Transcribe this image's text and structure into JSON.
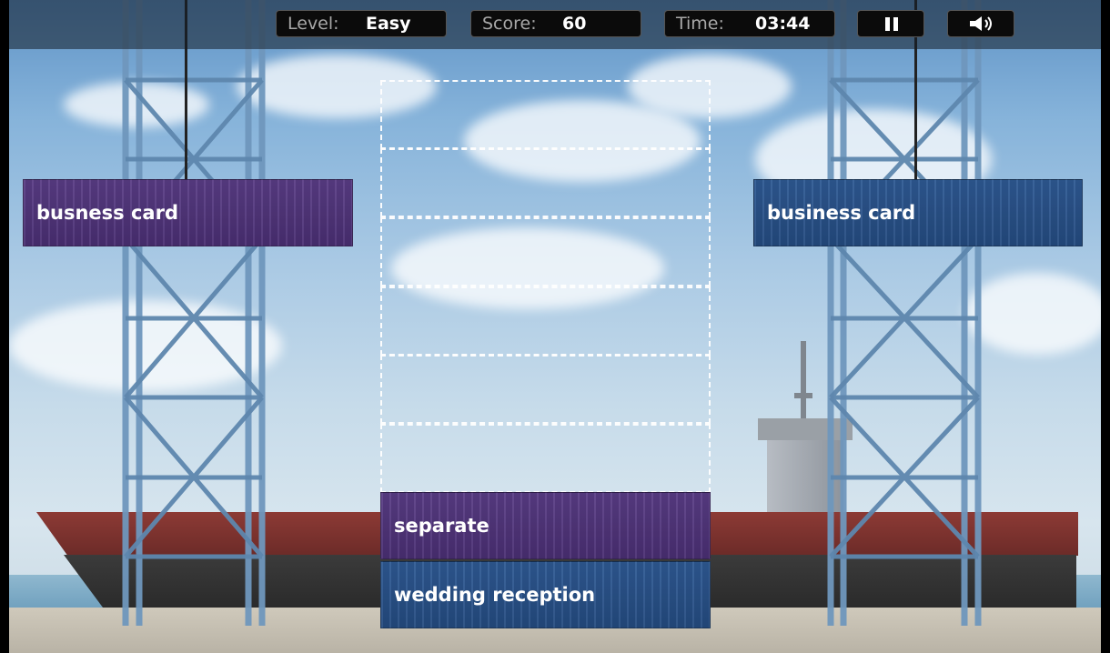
{
  "hud": {
    "level_label": "Level:",
    "level_value": "Easy",
    "score_label": "Score:",
    "score_value": "60",
    "time_label": "Time:",
    "time_value": "03:44",
    "pause_icon": "pause-icon",
    "sound_icon": "speaker-icon"
  },
  "cranes": {
    "left_container": {
      "text": "busness card",
      "color": "#4a2f73"
    },
    "right_container": {
      "text": "business card",
      "color": "#244b80"
    }
  },
  "stack": {
    "slots_empty": 6,
    "placed": [
      {
        "text": "separate",
        "color": "#4a2f73"
      },
      {
        "text": "wedding reception",
        "color": "#244b80"
      }
    ]
  },
  "colors": {
    "purple": "#4a2f73",
    "blue": "#244b80",
    "hud_bg": "#0b0b0b"
  }
}
